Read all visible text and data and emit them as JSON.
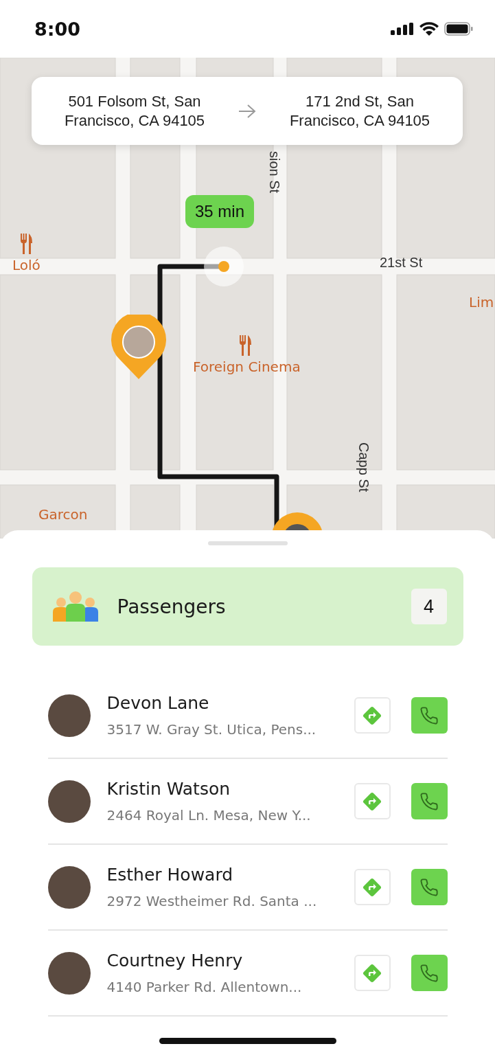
{
  "status_bar": {
    "time": "8:00"
  },
  "route": {
    "from": "501 Folsom St, San Francisco, CA 94105",
    "to": "171 2nd St, San Francisco, CA 94105",
    "eta": "35 min"
  },
  "map_labels": [
    {
      "text": "Loló",
      "kind": "place"
    },
    {
      "text": "21st St",
      "kind": "street"
    },
    {
      "text": "sion St",
      "kind": "street-vertical"
    },
    {
      "text": "Foreign Cinema",
      "kind": "place"
    },
    {
      "text": "Lim",
      "kind": "place"
    },
    {
      "text": "Capp St",
      "kind": "street-vertical"
    },
    {
      "text": "Garcon",
      "kind": "place"
    }
  ],
  "passengers": {
    "title": "Passengers",
    "count": "4",
    "items": [
      {
        "name": "Devon Lane",
        "address": "3517 W. Gray St. Utica, Pens..."
      },
      {
        "name": "Kristin Watson",
        "address": "2464 Royal Ln. Mesa, New Y..."
      },
      {
        "name": "Esther Howard",
        "address": "2972 Westheimer Rd. Santa ..."
      },
      {
        "name": "Courtney Henry",
        "address": "4140 Parker Rd. Allentown..."
      }
    ]
  }
}
